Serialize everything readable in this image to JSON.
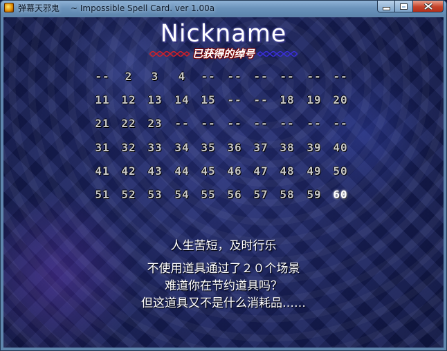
{
  "window": {
    "app_name": "弹幕天邪鬼",
    "title": "~ Impossible Spell Card. ver 1.00a",
    "icon": "app-icon",
    "controls": [
      "minimize-icon",
      "maximize-icon",
      "close-icon"
    ]
  },
  "heading": {
    "title": "Nickname",
    "subtitle": "已获得的绰号"
  },
  "nickname_grid": {
    "rows": [
      [
        "--",
        "2",
        "3",
        "4",
        "--",
        "--",
        "--",
        "--",
        "--",
        "--"
      ],
      [
        "11",
        "12",
        "13",
        "14",
        "15",
        "--",
        "--",
        "18",
        "19",
        "20"
      ],
      [
        "21",
        "22",
        "23",
        "--",
        "--",
        "--",
        "--",
        "--",
        "--",
        "--"
      ],
      [
        "31",
        "32",
        "33",
        "34",
        "35",
        "36",
        "37",
        "38",
        "39",
        "40"
      ],
      [
        "41",
        "42",
        "43",
        "44",
        "45",
        "46",
        "47",
        "48",
        "49",
        "50"
      ],
      [
        "51",
        "52",
        "53",
        "54",
        "55",
        "56",
        "57",
        "58",
        "59",
        "60"
      ]
    ],
    "selected": "60",
    "colors": {
      "normal": "#c8c8c8",
      "selected": "#ffffff"
    }
  },
  "description": {
    "motto": "人生苦短，及时行乐",
    "lines": [
      "不使用道具通过了２０个场景",
      "难道你在节约道具吗？",
      "但这道具又不是什么消耗品……"
    ]
  }
}
